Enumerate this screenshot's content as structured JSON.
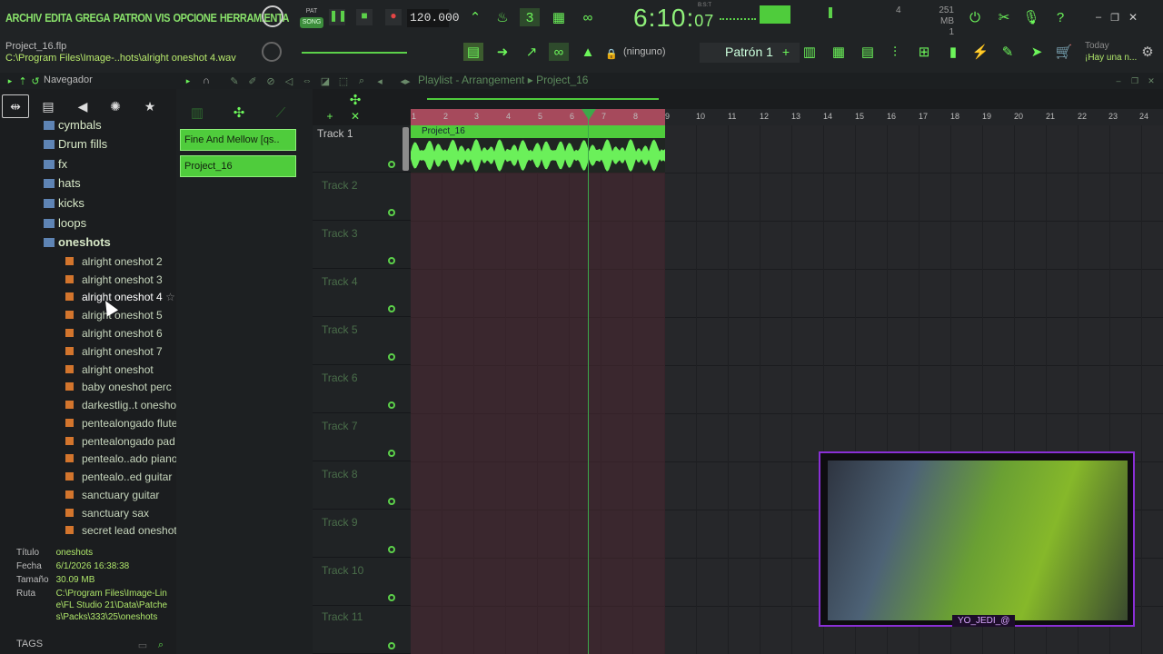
{
  "menu": [
    "ARCHIV",
    "EDITA",
    "GREGA",
    "PATRON",
    "VIS",
    "OPCIONE",
    "HERRAMIENTA"
  ],
  "transport": {
    "pat": "PAT",
    "song": "SONG",
    "tempo": "120.000",
    "time_main": "6:10:",
    "time_sub": "07",
    "time_label": "B:S:T"
  },
  "memory": {
    "mb": "251 MB",
    "count": "1",
    "cpu": "4"
  },
  "project": {
    "file": "Project_16.flp",
    "path": "C:\\Program Files\\Image-..hots\\alright oneshot 4.wav"
  },
  "toolbar": {
    "ninguno": "(ninguno)",
    "patron": "Patrón 1"
  },
  "news": {
    "date": "Today",
    "headline": "¡Hay una n..."
  },
  "browser": {
    "title": "Navegador",
    "folders": [
      "cymbals",
      "Drum fills",
      "fx",
      "hats",
      "kicks",
      "loops",
      "oneshots"
    ],
    "files": [
      "alright oneshot 2",
      "alright oneshot 3",
      "alright oneshot 4",
      "alright oneshot 5",
      "alright oneshot 6",
      "alright oneshot 7",
      "alright oneshot",
      "baby oneshot perc",
      "darkestlig..t oneshot",
      "pentealongado flute",
      "pentealongado pad",
      "pentealo..ado piano",
      "pentealo..ed guitar",
      "sanctuary guitar",
      "sanctuary sax",
      "secret lead oneshot"
    ],
    "info": {
      "titulo_k": "Título",
      "titulo_v": "oneshots",
      "fecha_k": "Fecha",
      "fecha_v": "6/1/2026 16:38:38",
      "tam_k": "Tamaño",
      "tam_v": "30.09 MB",
      "ruta_k": "Ruta",
      "ruta_v": "C:\\Program Files\\Image-Line\\FL Studio 21\\Data\\Patches\\Packs\\333\\25\\oneshots"
    },
    "tags": "TAGS"
  },
  "picker": [
    "Fine And Mellow [qs..",
    "Project_16"
  ],
  "playlist": {
    "title": "Playlist - Arrangement",
    "project": "Project_16",
    "ticks": [
      "1",
      "2",
      "3",
      "4",
      "5",
      "6",
      "7",
      "8",
      "9",
      "10",
      "11",
      "12",
      "13",
      "14",
      "15",
      "16",
      "17",
      "18",
      "19",
      "20",
      "21",
      "22",
      "23",
      "24"
    ],
    "clip": "Project_16",
    "tracks": [
      "Track 1",
      "Track 2",
      "Track 3",
      "Track 4",
      "Track 5",
      "Track 6",
      "Track 7",
      "Track 8",
      "Track 9",
      "Track 10",
      "Track 11"
    ]
  },
  "webcam": {
    "handle": "YO_JEDI_@"
  }
}
